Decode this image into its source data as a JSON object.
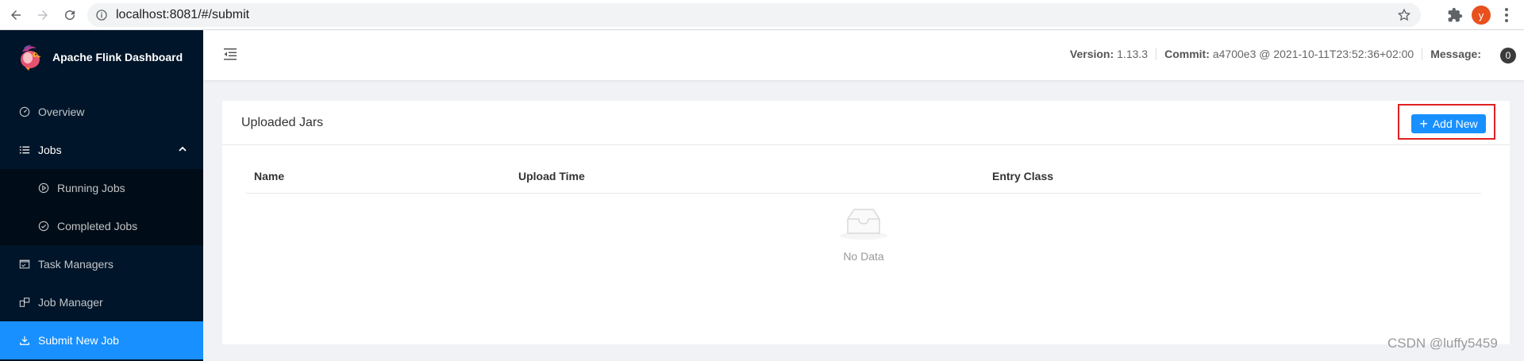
{
  "browser": {
    "url": "localhost:8081/#/submit",
    "profile_initial": "y"
  },
  "sidebar": {
    "app_title": "Apache Flink Dashboard",
    "items": [
      {
        "label": "Overview",
        "icon": "dashboard-icon"
      },
      {
        "label": "Jobs",
        "icon": "list-icon",
        "expanded": true
      },
      {
        "label": "Running Jobs",
        "icon": "play-circle-icon"
      },
      {
        "label": "Completed Jobs",
        "icon": "check-circle-icon"
      },
      {
        "label": "Task Managers",
        "icon": "schedule-icon"
      },
      {
        "label": "Job Manager",
        "icon": "build-icon"
      },
      {
        "label": "Submit New Job",
        "icon": "upload-icon",
        "active": true
      }
    ],
    "active_color": "#1890ff",
    "background": "#001529"
  },
  "header": {
    "version_label": "Version:",
    "version_value": "1.13.3",
    "commit_label": "Commit:",
    "commit_value": "a4700e3 @ 2021-10-11T23:52:36+02:00",
    "message_label": "Message:",
    "message_count": "0"
  },
  "card": {
    "title": "Uploaded Jars",
    "add_button_label": "Add New",
    "columns": [
      "Name",
      "Upload Time",
      "Entry Class"
    ],
    "empty_text": "No Data"
  },
  "watermark": "CSDN @luffy5459"
}
